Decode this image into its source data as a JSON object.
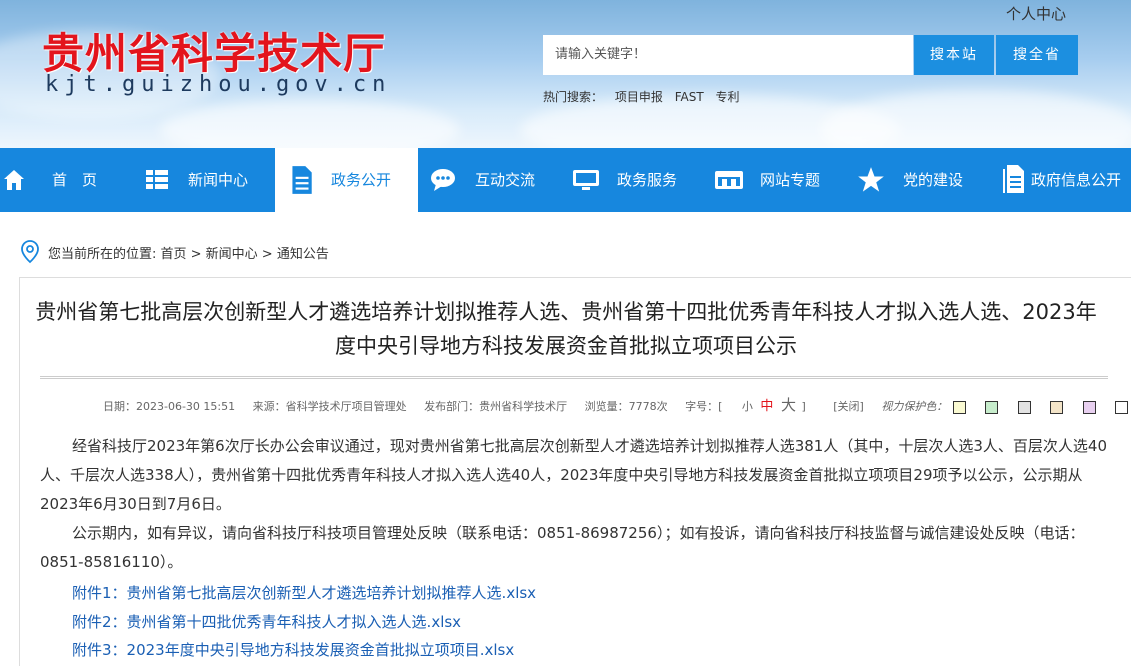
{
  "header": {
    "site_title": "贵州省科学技术厅",
    "site_domain": "kjt.guizhou.gov.cn",
    "personal_center": "个人中心",
    "search_placeholder": "请输入关键字！",
    "search_station": "搜本站",
    "search_province": "搜全省",
    "hot_label": "热门搜索：",
    "hot_terms": [
      "项目申报",
      "FAST",
      "专利"
    ]
  },
  "nav": {
    "items": [
      {
        "label": "首　页",
        "icon": "home-icon"
      },
      {
        "label": "新闻中心",
        "icon": "list-icon"
      },
      {
        "label": "政务公开",
        "icon": "document-icon",
        "active": true
      },
      {
        "label": "互动交流",
        "icon": "chat-icon"
      },
      {
        "label": "政务服务",
        "icon": "monitor-icon"
      },
      {
        "label": "网站专题",
        "icon": "window-icon"
      },
      {
        "label": "党的建设",
        "icon": "star-icon"
      },
      {
        "label": "政府信息公开",
        "icon": "file-icon"
      }
    ]
  },
  "breadcrumb": "您当前所在的位置: 首页 > 新闻中心 > 通知公告",
  "article": {
    "title": "贵州省第七批高层次创新型人才遴选培养计划拟推荐人选、贵州省第十四批优秀青年科技人才拟入选人选、2023年度中央引导地方科技发展资金首批拟立项项目公示",
    "meta": {
      "date": "日期：2023-06-30 15:51",
      "source": "来源：省科学技术厅项目管理处",
      "dept": "发布部门：贵州省科学技术厅",
      "views": "浏览量：7778次",
      "font_label": "字号：[",
      "font_small": "小",
      "font_medium": "中",
      "font_large": "大",
      "font_close": "]",
      "close": "[关闭]",
      "eye_label": "视力保护色："
    },
    "eye_colors": [
      "#fafad2",
      "#c7edcc",
      "#e3e3e3",
      "#f3e4c8",
      "#e8d0f0",
      "#ffffff"
    ],
    "paragraphs": [
      "经省科技厅2023年第6次厅长办公会审议通过，现对贵州省第七批高层次创新型人才遴选培养计划拟推荐人选381人（其中，十层次人选3人、百层次人选40人、千层次人选338人），贵州省第十四批优秀青年科技人才拟入选人选40人，2023年度中央引导地方科技发展资金首批拟立项项目29项予以公示，公示期从2023年6月30日到7月6日。",
      "公示期内，如有异议，请向省科技厅科技项目管理处反映（联系电话：0851-86987256）；如有投诉，请向省科技厅科技监督与诚信建设处反映（电话：0851-85816110）。"
    ],
    "attachments": [
      "附件1：贵州省第七批高层次创新型人才遴选培养计划拟推荐人选.xlsx",
      "附件2：贵州省第十四批优秀青年科技人才拟入选人选.xlsx",
      "附件3：2023年度中央引导地方科技发展资金首批拟立项项目.xlsx"
    ]
  }
}
